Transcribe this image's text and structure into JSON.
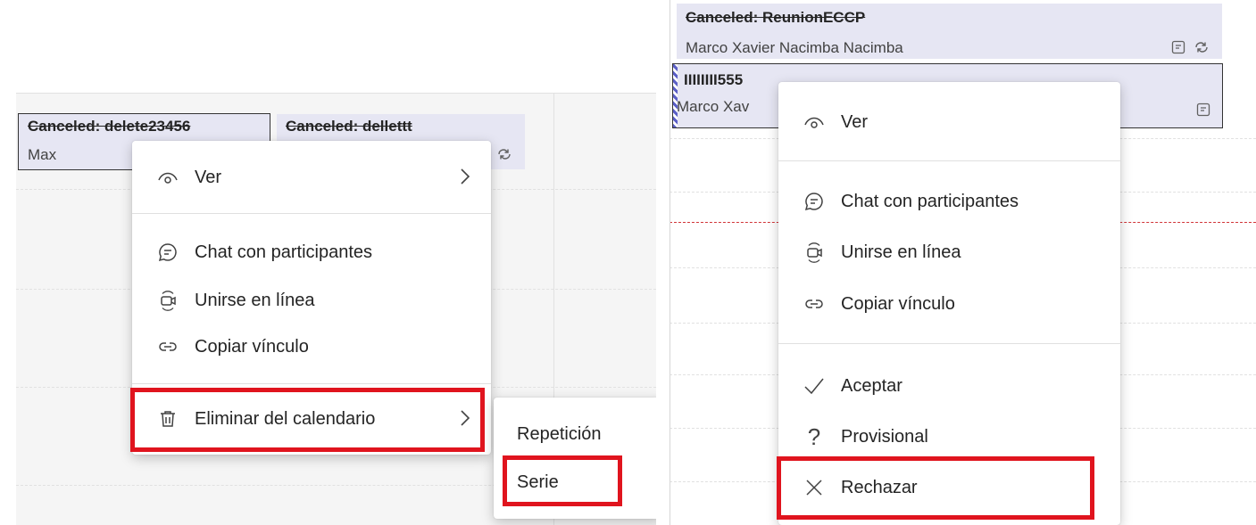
{
  "left": {
    "events": [
      {
        "title": "Canceled: delete23456",
        "subtitle": "Max"
      },
      {
        "title": "Canceled: dellettt"
      }
    ],
    "context_menu": {
      "items": [
        {
          "label": "Ver",
          "icon": "eye-icon",
          "has_submenu": true
        },
        {
          "label": "Chat con participantes",
          "icon": "chat-icon"
        },
        {
          "label": "Unirse en línea",
          "icon": "video-icon"
        },
        {
          "label": "Copiar vínculo",
          "icon": "link-icon"
        },
        {
          "label": "Eliminar del calendario",
          "icon": "trash-icon",
          "has_submenu": true,
          "highlighted": true
        }
      ]
    },
    "submenu": {
      "items": [
        {
          "label": "Repetición"
        },
        {
          "label": "Serie",
          "highlighted": true
        }
      ]
    }
  },
  "right": {
    "events": [
      {
        "title": "Canceled: ReunionECCP",
        "subtitle": "Marco Xavier Nacimba Nacimba"
      },
      {
        "title": "IIIIIIII555",
        "subtitle": "Marco Xav"
      }
    ],
    "context_menu": {
      "items": [
        {
          "label": "Ver",
          "icon": "eye-icon"
        },
        {
          "label": "Chat con participantes",
          "icon": "chat-icon"
        },
        {
          "label": "Unirse en línea",
          "icon": "video-icon"
        },
        {
          "label": "Copiar vínculo",
          "icon": "link-icon"
        },
        {
          "label": "Aceptar",
          "icon": "checkmark-icon"
        },
        {
          "label": "Provisional",
          "icon": "question-icon"
        },
        {
          "label": "Rechazar",
          "icon": "close-icon",
          "highlighted": true
        }
      ]
    }
  },
  "colors": {
    "highlight": "#e0141e",
    "event_bg": "#e6e6f3",
    "now_line": "#d13438"
  }
}
